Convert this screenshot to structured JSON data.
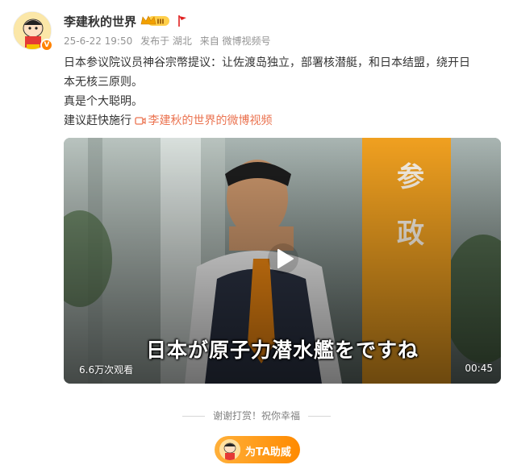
{
  "post": {
    "author": "李建秋的世界",
    "vip_level": "III",
    "meta": {
      "time": "25-6-22 19:50",
      "location": "发布于 湖北",
      "source": "来自 微博视频号"
    },
    "text_lines": [
      "日本参议院议员神谷宗幣提议：让佐渡岛独立，部署核潜艇，和日本结盟，绕开日",
      "本无核三原则。",
      "真是个大聪明。",
      "建议赶快施行"
    ],
    "video_link": "李建秋的世界的微博视频"
  },
  "video": {
    "subtitle": "日本が原子力潜水艦をですね",
    "views": "6.6万次观看",
    "duration": "00:45"
  },
  "footer": {
    "thanks": "谢谢打赏！祝你幸福",
    "support_button": "为TA助威"
  },
  "colors": {
    "accent": "#ff8200",
    "link": "#eb7350",
    "meta_text": "#939393"
  }
}
